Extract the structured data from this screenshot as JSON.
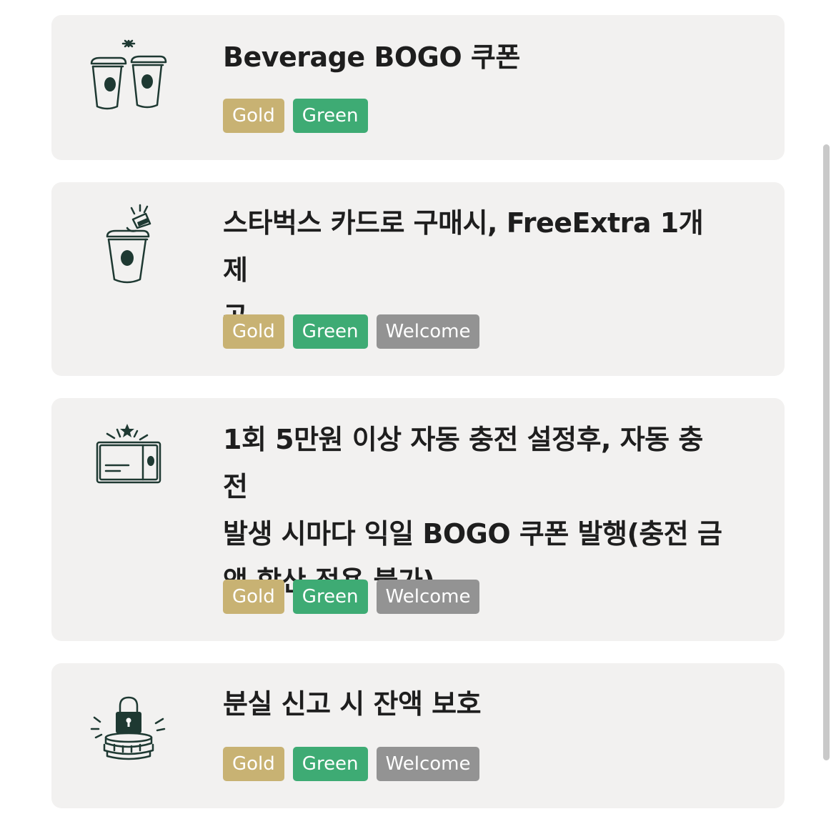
{
  "benefits": [
    {
      "title": "Beverage BOGO 쿠폰",
      "icon": "two-cups-icon",
      "tags": [
        "Gold",
        "Green"
      ]
    },
    {
      "title": "스타벅스 카드로 구매시, FreeExtra 1개 제공",
      "title_lines": [
        "스타벅스 카드로 구매시, FreeExtra 1개 제",
        "공"
      ],
      "icon": "cup-with-topping-icon",
      "tags": [
        "Gold",
        "Green",
        "Welcome"
      ]
    },
    {
      "title": "1회 5만원 이상 자동 충전 설정후, 자동 충전 발생 시마다 익일 BOGO 쿠폰 발행(충전 금액 합산 적용 불가)",
      "title_lines": [
        "1회 5만원 이상 자동 충전 설정후, 자동 충전",
        "발생 시마다 익일 BOGO 쿠폰 발행(충전 금",
        "액 합산 적용 불가)"
      ],
      "icon": "card-icon",
      "tags": [
        "Gold",
        "Green",
        "Welcome"
      ]
    },
    {
      "title": "분실 신고 시 잔액 보호",
      "icon": "lock-coins-icon",
      "tags": [
        "Gold",
        "Green",
        "Welcome"
      ]
    }
  ],
  "colors": {
    "card_background": "#f2f1f0",
    "gold": "#c8b273",
    "green": "#3eab74",
    "welcome": "#939393",
    "icon_dark": "#1e3932"
  }
}
